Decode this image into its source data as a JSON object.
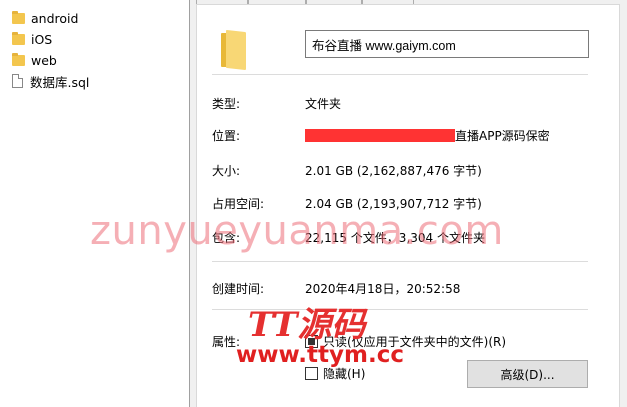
{
  "explorer": {
    "items": [
      {
        "name": "android",
        "icon": "folder-icon"
      },
      {
        "name": "iOS",
        "icon": "folder-icon"
      },
      {
        "name": "web",
        "icon": "folder-icon"
      },
      {
        "name": "数据库.sql",
        "icon": "document-icon"
      }
    ]
  },
  "properties": {
    "folder_name": "布谷直播 www.gaiym.com",
    "type_label": "类型:",
    "type_value": "文件夹",
    "location_label": "位置:",
    "location_value": "直播APP源码保密",
    "size_label": "大小:",
    "size_value": "2.01 GB (2,162,887,476 字节)",
    "disk_size_label": "占用空间:",
    "disk_size_value": "2.04 GB (2,193,907,712 字节)",
    "contains_label": "包含:",
    "contains_value": "22,115 个文件，3,304 个文件夹",
    "created_label": "创建时间:",
    "created_value": "2020年4月18日，20:52:58",
    "attributes_label": "属性:",
    "readonly_label": "只读(仅应用于文件夹中的文件)(R)",
    "hidden_label": "隐藏(H)",
    "advanced_button": "高级(D)..."
  },
  "watermark": {
    "main": "zunyueyuanma.com",
    "logo": "TT源码",
    "url": "www.ttym.cc"
  },
  "colors": {
    "redaction": "#ff3333",
    "watermark_pink": "#ec6e78",
    "watermark_red": "#e02020"
  }
}
